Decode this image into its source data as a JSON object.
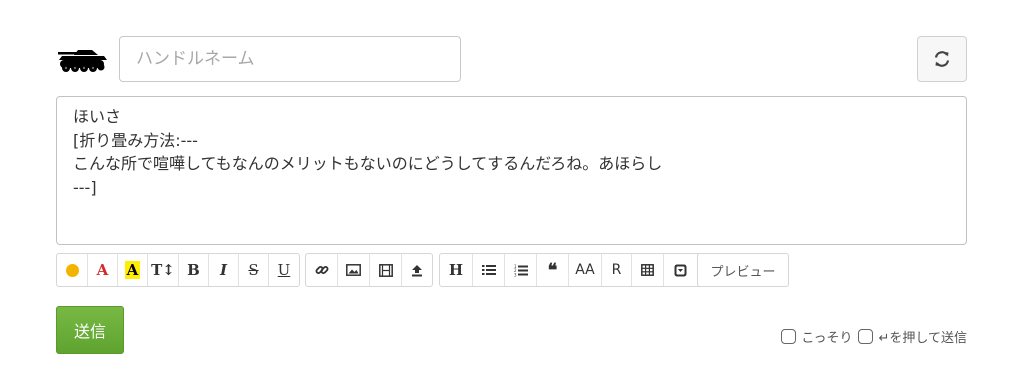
{
  "header": {
    "avatar_icon": "tank-icon",
    "handle_placeholder": "ハンドルネーム",
    "handle_value": "",
    "refresh_icon": "refresh-icon"
  },
  "message": {
    "text": "ほいさ\n[折り畳み方法:---\nこんな所で喧嘩してもなんのメリットもないのにどうしてするんだろね。あほらし\n---]"
  },
  "toolbar": {
    "groups": [
      [
        {
          "name": "emoji-icon",
          "label": "☻",
          "color": "#e0a000"
        },
        {
          "name": "font-color-button",
          "label": "A",
          "color": "#d32b2b"
        },
        {
          "name": "highlight-button",
          "label": "A",
          "color": "#000000",
          "bg": "#ffee00"
        },
        {
          "name": "font-size-button",
          "label": "T↕",
          "color": "#333333"
        },
        {
          "name": "bold-button",
          "label": "B",
          "color": "#333333"
        },
        {
          "name": "italic-button",
          "label": "I",
          "color": "#333333"
        },
        {
          "name": "strikethrough-button",
          "label": "S",
          "color": "#333333"
        },
        {
          "name": "underline-button",
          "label": "U",
          "color": "#333333"
        }
      ],
      [
        {
          "name": "link-icon",
          "label": "🔗",
          "color": "#333333"
        },
        {
          "name": "image-icon",
          "label": "▣",
          "color": "#333333"
        },
        {
          "name": "video-icon",
          "label": "▤",
          "color": "#333333"
        },
        {
          "name": "upload-icon",
          "label": "⇪",
          "color": "#333333"
        }
      ],
      [
        {
          "name": "heading-button",
          "label": "H",
          "color": "#333333"
        },
        {
          "name": "bullet-list-icon",
          "label": "☰",
          "color": "#333333"
        },
        {
          "name": "numbered-list-icon",
          "label": "≡",
          "color": "#333333"
        },
        {
          "name": "quote-icon",
          "label": "❝",
          "color": "#333333"
        },
        {
          "name": "aa-button",
          "label": "AA",
          "color": "#333333"
        },
        {
          "name": "ruby-button",
          "label": "R",
          "color": "#333333"
        },
        {
          "name": "table-icon",
          "label": "⊞",
          "color": "#333333"
        },
        {
          "name": "collapse-icon",
          "label": "⊡",
          "color": "#333333"
        }
      ]
    ],
    "preview_label": "プレビュー"
  },
  "footer": {
    "send_label": "送信",
    "option_secret": "こっそり",
    "option_enter_send": "↵を押して送信"
  },
  "colors": {
    "send_green": "#6aac38",
    "font_red": "#d32b2b",
    "highlight_yellow": "#ffee00"
  }
}
